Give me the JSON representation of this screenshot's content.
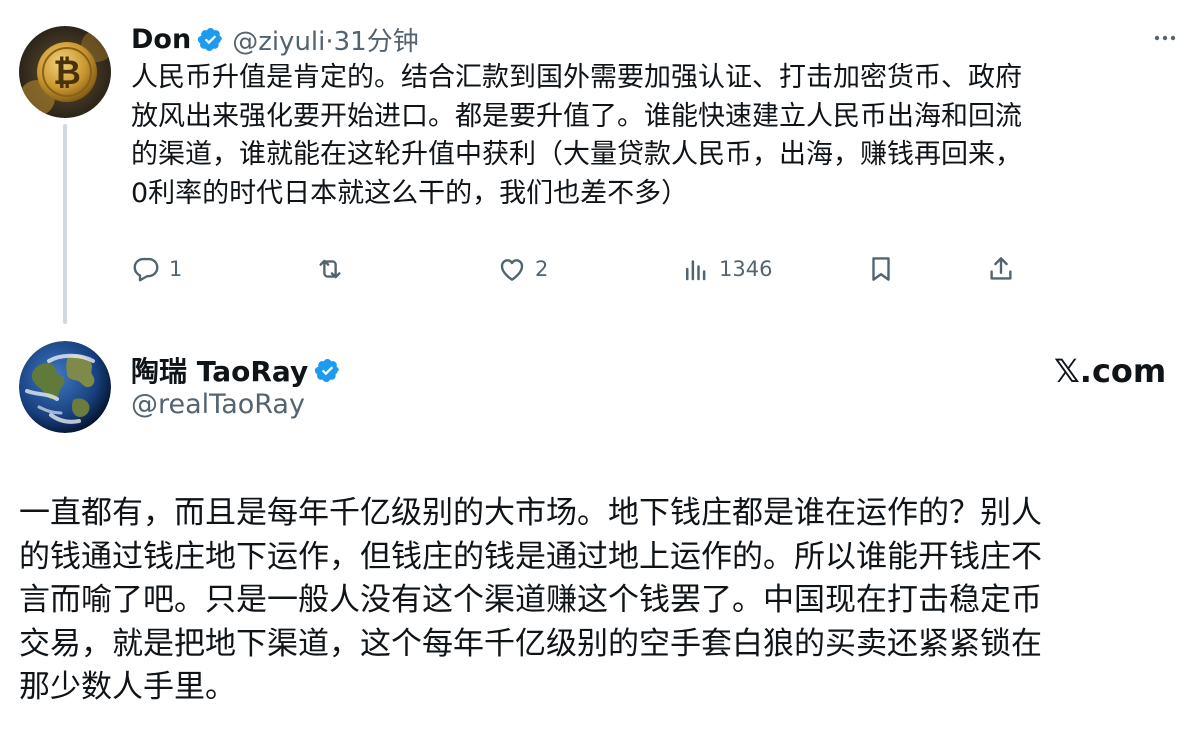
{
  "tweet_reply_target": {
    "author": {
      "display_name": "Don",
      "handle_time": "@ziyuli·31分钟",
      "verified": true,
      "avatar_icon": "bitcoin-icon"
    },
    "text": "人民币升值是肯定的。结合汇款到国外需要加强认证、打击加密货币、政府\n放风出来强化要开始进口。都是要升值了。谁能快速建立人民币出海和回流\n的渠道，谁就能在这轮升值中获利（大量贷款人民币，出海，赚钱再回来，\n0利率的时代日本就这么干的，我们也差不多）",
    "actions": {
      "replies": "1",
      "retweets": "",
      "likes": "2",
      "views": "1346"
    }
  },
  "tweet_main": {
    "author": {
      "display_name": "陶瑞 TaoRay",
      "handle": "@realTaoRay",
      "verified": true,
      "avatar_icon": "earth-icon"
    },
    "text": "一直都有，而且是每年千亿级别的大市场。地下钱庄都是谁在运作的？别人\n的钱通过钱庄地下运作，但钱庄的钱是通过地上运作的。所以谁能开钱庄不\n言而喻了吧。只是一般人没有这个渠道赚这个钱罢了。中国现在打击稳定币\n交易，就是把地下渠道，这个每年千亿级别的空手套白狼的买卖还紧紧锁在\n那少数人手里。"
  },
  "watermark": "𝕏.com",
  "colors": {
    "text": "#0f1419",
    "secondary": "#536471",
    "verified_blue": "#1d9bf0",
    "thread_line": "#cfd9de"
  }
}
